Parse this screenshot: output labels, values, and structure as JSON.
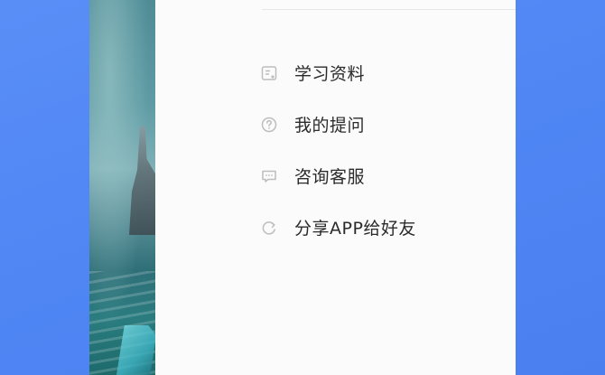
{
  "menu": {
    "items": [
      {
        "label": "学习资料",
        "icon": "document-icon"
      },
      {
        "label": "我的提问",
        "icon": "question-icon"
      },
      {
        "label": "咨询客服",
        "icon": "chat-icon"
      },
      {
        "label": "分享APP给好友",
        "icon": "share-icon"
      }
    ]
  },
  "colors": {
    "background": "#4f86f4",
    "drawer": "#fbfbfb",
    "text": "#2b2b2b",
    "icon": "#bdbdbd"
  }
}
